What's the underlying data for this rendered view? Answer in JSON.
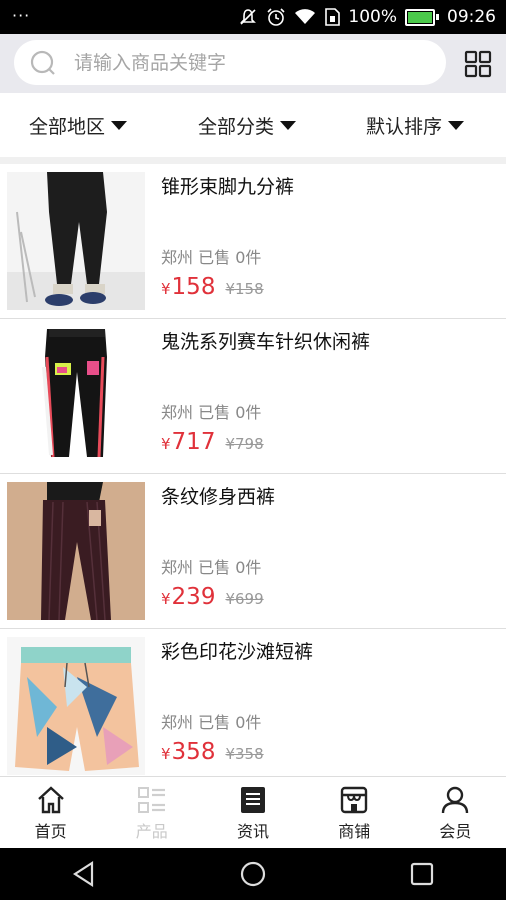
{
  "status_bar": {
    "menu_dots": "···",
    "battery_percent": "100%",
    "time": "09:26"
  },
  "search": {
    "placeholder": "请输入商品关键字"
  },
  "filters": [
    {
      "label": "全部地区"
    },
    {
      "label": "全部分类"
    },
    {
      "label": "默认排序"
    }
  ],
  "products": [
    {
      "title": "锥形束脚九分裤",
      "location": "郑州",
      "sold": "已售 0件",
      "price": "158",
      "original_price": "¥158"
    },
    {
      "title": "鬼洗系列赛车针织休闲裤",
      "location": "郑州",
      "sold": "已售 0件",
      "price": "717",
      "original_price": "¥798"
    },
    {
      "title": "条纹修身西裤",
      "location": "郑州",
      "sold": "已售 0件",
      "price": "239",
      "original_price": "¥699"
    },
    {
      "title": "彩色印花沙滩短裤",
      "location": "郑州",
      "sold": "已售 0件",
      "price": "358",
      "original_price": "¥358"
    }
  ],
  "currency_symbol": "¥",
  "tabs": [
    {
      "label": "首页",
      "icon": "home-icon"
    },
    {
      "label": "产品",
      "icon": "list-icon",
      "disabled": true
    },
    {
      "label": "资讯",
      "icon": "news-icon"
    },
    {
      "label": "商铺",
      "icon": "store-icon"
    },
    {
      "label": "会员",
      "icon": "user-icon"
    }
  ],
  "colors": {
    "price": "#e0313a",
    "status_bar": "#000000",
    "search_bg": "#e9e9ee",
    "battery": "#4cc94c"
  }
}
